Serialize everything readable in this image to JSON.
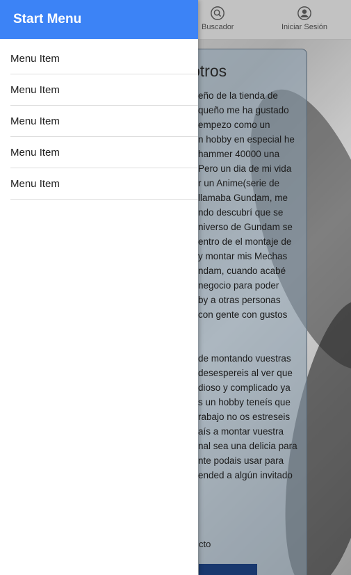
{
  "drawer": {
    "title": "Start Menu",
    "items": [
      {
        "label": "Menu Item"
      },
      {
        "label": "Menu Item"
      },
      {
        "label": "Menu Item"
      },
      {
        "label": "Menu Item"
      },
      {
        "label": "Menu Item"
      }
    ]
  },
  "topnav": {
    "search_label": "Buscador",
    "login_label": "Iniciar Sesión",
    "search_icon": "search-icon",
    "login_icon": "user-circle-icon"
  },
  "card": {
    "title_partial": "otros",
    "body_lines": [
      "eño de la tienda de",
      "queño me ha gustado",
      " empezo como un",
      "n hobby en especial he",
      "hammer 40000 una",
      "Pero un dia de mi vida",
      "r un Anime(serie de",
      " llamaba Gundam, me",
      "ndo descubrí que se",
      "niverso de Gundam se",
      "entro de el montaje de",
      "y montar mis Mechas",
      "ndam, cuando acabé",
      " negocio para poder",
      "by a otras personas",
      "con gente con gustos",
      "",
      "",
      "de montando vuestras",
      "desespereis al ver que",
      "dioso y complicado ya",
      "s un hobby teneís que",
      "rabajo no os estreseis",
      "aís a montar vuestra",
      "nal sea una delicia para",
      "nte podais usar para",
      "ended a algún invitado"
    ],
    "footer_partial": "cto"
  },
  "colors": {
    "drawer_header": "#3c83f6",
    "card_strip": "#1c3d78"
  }
}
